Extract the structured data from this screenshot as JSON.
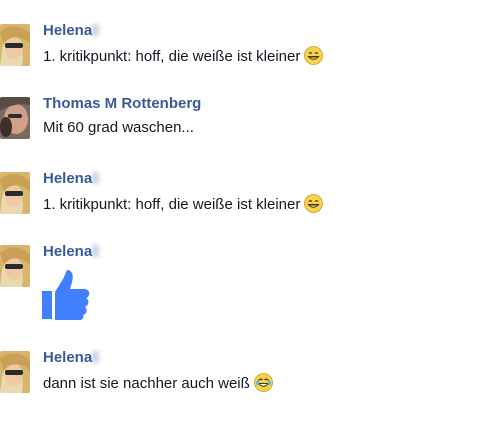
{
  "messages": [
    {
      "sender": "Helena",
      "text": "1. kritikpunkt: hoff, die weiße ist kleiner",
      "emoji": "grinning-face-icon"
    },
    {
      "sender": "Thomas M Rottenberg",
      "text": "Mit 60 grad waschen..."
    },
    {
      "sender": "Helena",
      "text": "1. kritikpunkt: hoff, die weiße ist kleiner",
      "emoji": "grinning-face-icon"
    },
    {
      "sender": "Helena",
      "sticker": "thumbs-up-icon"
    },
    {
      "sender": "Helena",
      "text": "dann ist sie nachher auch weiß",
      "emoji": "tears-of-joy-icon"
    }
  ],
  "colors": {
    "sender_name": "#3b5998",
    "message_text": "#141823",
    "like_blue": "#4080ff",
    "emoji_yellow": "#f7d34a"
  }
}
